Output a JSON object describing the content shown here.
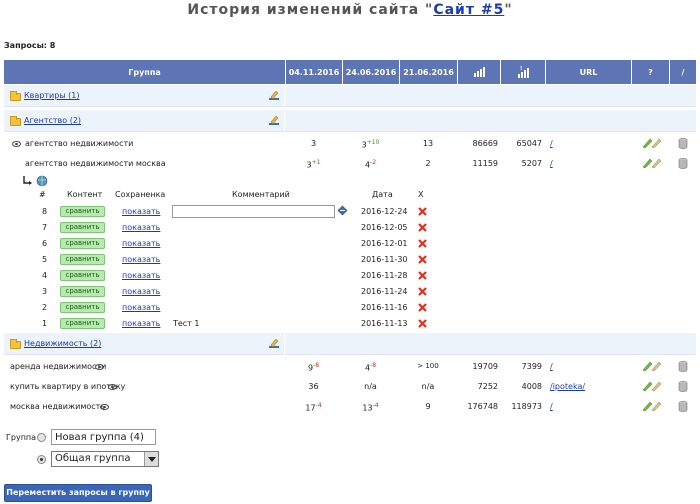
{
  "title": {
    "prefix": "История изменений сайта \"",
    "site": "Сайт #5",
    "suffix": "\""
  },
  "queries_label": "Запросы: 8",
  "header": {
    "group": "Группа",
    "d1": "04.11.2016",
    "d2": "24.06.2016",
    "d3": "21.06.2016",
    "url": "URL",
    "q": "?",
    "slash": "/"
  },
  "groups": {
    "g1": "Квартиры (1)",
    "g2": "Агентство (2)",
    "g3": "Недвижимость (2)"
  },
  "rows": {
    "r1": {
      "query": "агентство недвижимости",
      "v1": "3",
      "v2": "3",
      "v2d": "+10",
      "v3": "13",
      "n1": "86669",
      "n2": "65047",
      "url": "/"
    },
    "r2": {
      "query": "агентство недвижимости москва",
      "v1": "3",
      "v1d": "+1",
      "v2": "4",
      "v2d": "-2",
      "v3": "2",
      "n1": "11159",
      "n2": "5207",
      "url": "/"
    },
    "r3": {
      "query": "аренда недвижимости",
      "v1": "9",
      "v1d": "-8",
      "v2": "4",
      "v2d": "-8",
      "v3": "> 100",
      "n1": "19709",
      "n2": "7399",
      "url": "/"
    },
    "r4": {
      "query": "купить квартиру в ипотеку",
      "v1": "36",
      "v2": "n/a",
      "v3": "n/a",
      "n1": "7252",
      "n2": "4008",
      "url": "/ipoteka/"
    },
    "r5": {
      "query": "москва недвижимость",
      "v1": "17",
      "v1d": "-4",
      "v2": "13",
      "v2d": "-4",
      "v3": "9",
      "n1": "176748",
      "n2": "118973",
      "url": "/"
    }
  },
  "history": {
    "headers": {
      "num": "#",
      "content": "Контент",
      "saved": "Сохраненка",
      "comment": "Комментарий",
      "date": "Дата",
      "x": "X"
    },
    "compare": "сравнить",
    "show": "показать",
    "items": [
      {
        "n": "8",
        "date": "2016-12-24",
        "comment": ""
      },
      {
        "n": "7",
        "date": "2016-12-05",
        "comment": ""
      },
      {
        "n": "6",
        "date": "2016-12-01",
        "comment": ""
      },
      {
        "n": "5",
        "date": "2016-11-30",
        "comment": ""
      },
      {
        "n": "4",
        "date": "2016-11-28",
        "comment": ""
      },
      {
        "n": "3",
        "date": "2016-11-24",
        "comment": ""
      },
      {
        "n": "2",
        "date": "2016-11-16",
        "comment": ""
      },
      {
        "n": "1",
        "date": "2016-11-13",
        "comment": "Тест 1"
      }
    ]
  },
  "form": {
    "group_label": "Группа",
    "new_group_value": "Новая группа (4)",
    "select_value": "Общая группа",
    "move_button": "Переместить запросы в группу"
  }
}
